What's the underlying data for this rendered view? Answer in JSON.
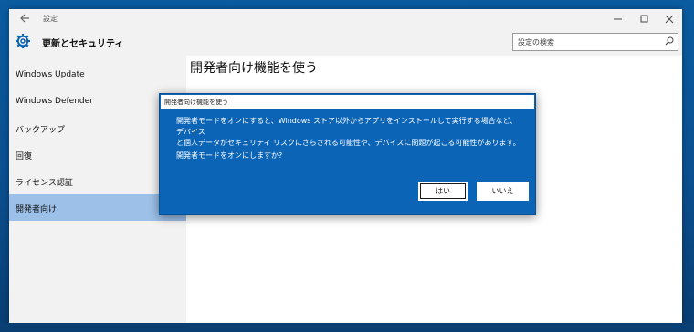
{
  "window": {
    "title": "設定",
    "controls": [
      "minimize",
      "maximize",
      "close"
    ]
  },
  "header": {
    "title": "更新とセキュリティ",
    "icon": "gear-icon"
  },
  "search": {
    "placeholder": "設定の検索",
    "icon": "search-icon"
  },
  "sidebar": {
    "items": [
      {
        "label": "Windows Update",
        "active": false
      },
      {
        "label": "Windows Defender",
        "active": false
      },
      {
        "label": "バックアップ",
        "active": false
      },
      {
        "label": "回復",
        "active": false
      },
      {
        "label": "ライセンス認証",
        "active": false
      },
      {
        "label": "開発者向け",
        "active": true
      }
    ]
  },
  "main": {
    "title": "開発者向け機能を使う"
  },
  "dialog": {
    "title": "開発者向け機能を使う",
    "message_line1": "開発者モードをオンにすると、Windows ストア以外からアプリをインストールして実行する場合など、デバイス",
    "message_line2": "と個人データがセキュリティ リスクにさらされる可能性や、デバイスに問題が起こる可能性があります。",
    "question": "開発者モードをオンにしますか?",
    "yes_label": "はい",
    "no_label": "いいえ"
  },
  "colors": {
    "accent": "#0b64b6",
    "sidebar_active": "#9cc0e8",
    "chrome": "#f2f2f2"
  }
}
